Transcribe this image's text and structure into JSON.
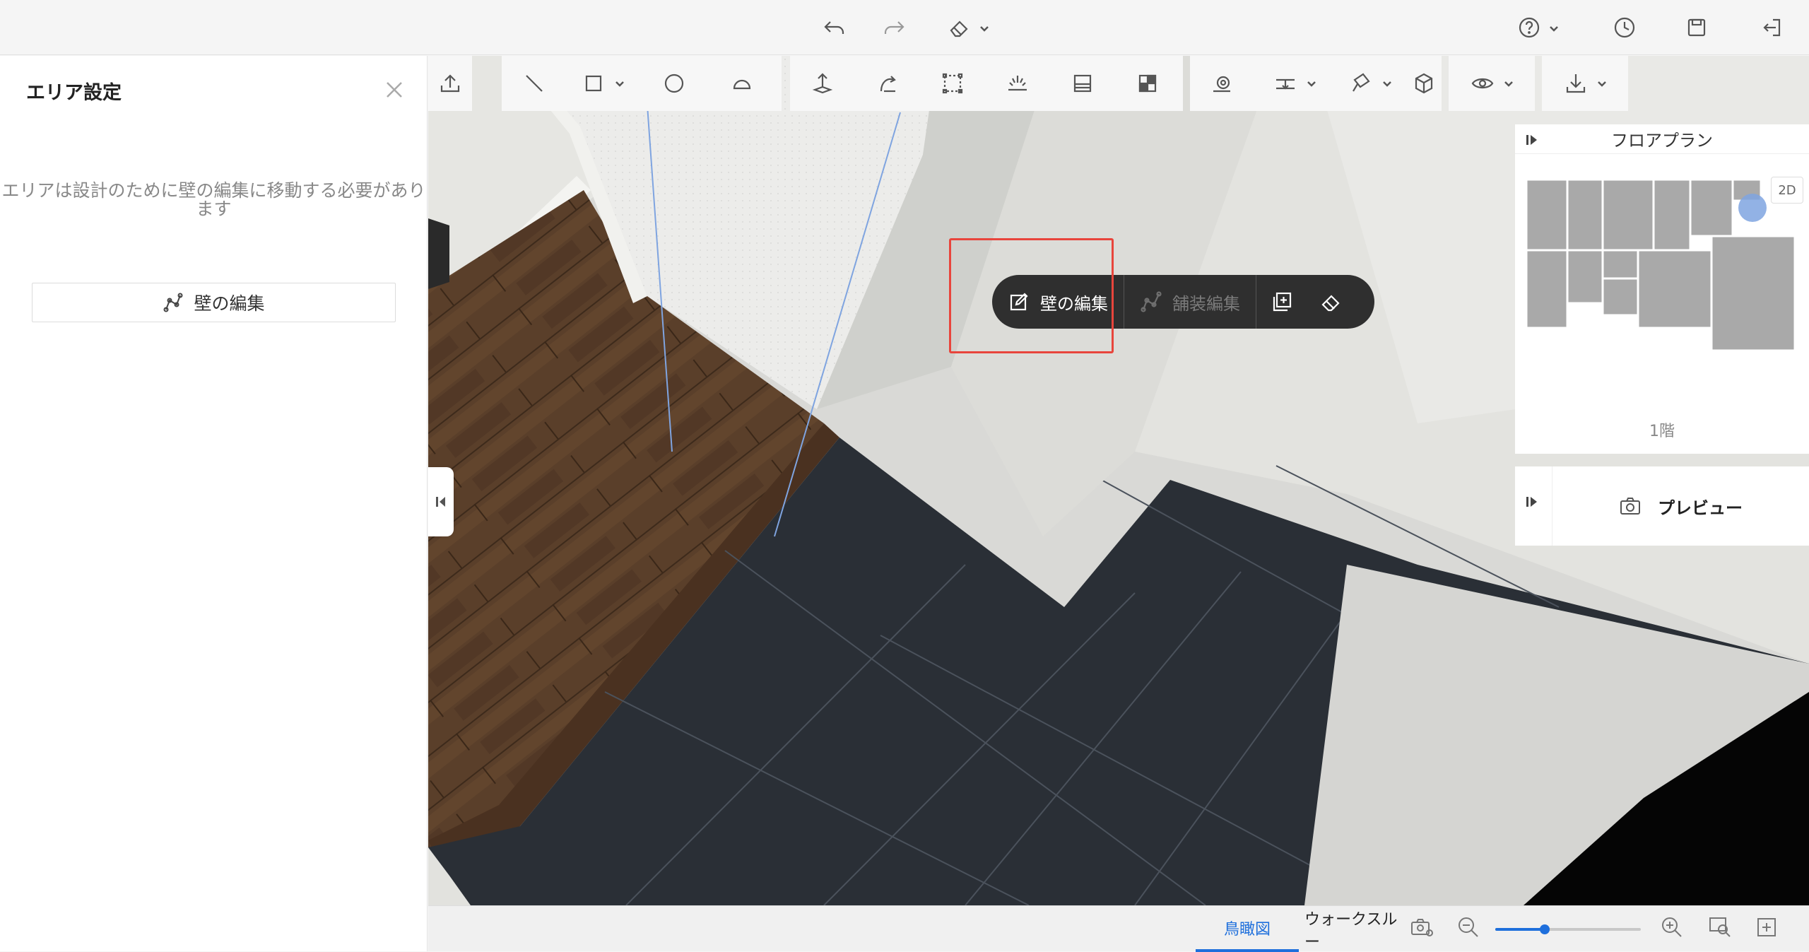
{
  "topbar": {
    "icons": [
      "undo-icon",
      "redo-icon",
      "eraser-icon",
      "help-icon",
      "history-icon",
      "save-icon",
      "exit-icon"
    ]
  },
  "left_panel": {
    "title": "エリア設定",
    "message_line1": "エリアは設計のために壁の編集に移動する必要があり",
    "message_line2": "ます",
    "edit_wall_button": "壁の編集"
  },
  "context_menu": {
    "edit_wall": "壁の編集",
    "edit_paving": "舗装編集",
    "edit_paving_enabled": false
  },
  "floorplan": {
    "title": "フロアプラン",
    "mode_label": "2D",
    "floor_label": "1階"
  },
  "preview": {
    "label": "プレビュー"
  },
  "bottom": {
    "tab_birdseye": "鳥瞰図",
    "tab_walkthrough": "ウォークスルー",
    "active_tab": "鳥瞰図",
    "zoom_level_fraction": 0.34
  },
  "colors": {
    "accent": "#1e6fdc",
    "highlight": "#e8453c",
    "context_menu_bg": "#2f2f2f"
  }
}
